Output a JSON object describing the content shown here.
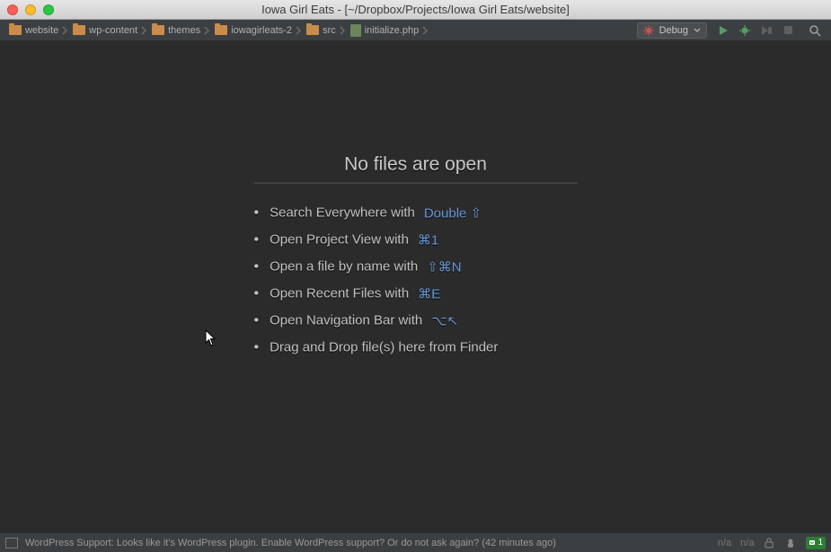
{
  "window": {
    "title": "Iowa Girl Eats - [~/Dropbox/Projects/Iowa Girl Eats/website]"
  },
  "breadcrumbs": [
    {
      "label": "website",
      "kind": "folder"
    },
    {
      "label": "wp-content",
      "kind": "folder"
    },
    {
      "label": "themes",
      "kind": "folder"
    },
    {
      "label": "iowagirleats-2",
      "kind": "folder"
    },
    {
      "label": "src",
      "kind": "folder"
    },
    {
      "label": "initialize.php",
      "kind": "file"
    }
  ],
  "toolbar": {
    "run_config": "Debug"
  },
  "empty_state": {
    "title": "No files are open",
    "tips": [
      {
        "text": "Search Everywhere with",
        "key": "Double ⇧"
      },
      {
        "text": "Open Project View with",
        "key": "⌘1"
      },
      {
        "text": "Open a file by name with",
        "key": "⇧⌘N"
      },
      {
        "text": "Open Recent Files with",
        "key": "⌘E"
      },
      {
        "text": "Open Navigation Bar with",
        "key": "⌥↖"
      },
      {
        "text": "Drag and Drop file(s) here from Finder",
        "key": ""
      }
    ]
  },
  "status": {
    "message": "WordPress Support: Looks like it's WordPress plugin. Enable WordPress support? Or do not ask again? (42 minutes ago)",
    "insets": {
      "left": "n/a",
      "right": "n/a"
    },
    "badge": "1"
  }
}
